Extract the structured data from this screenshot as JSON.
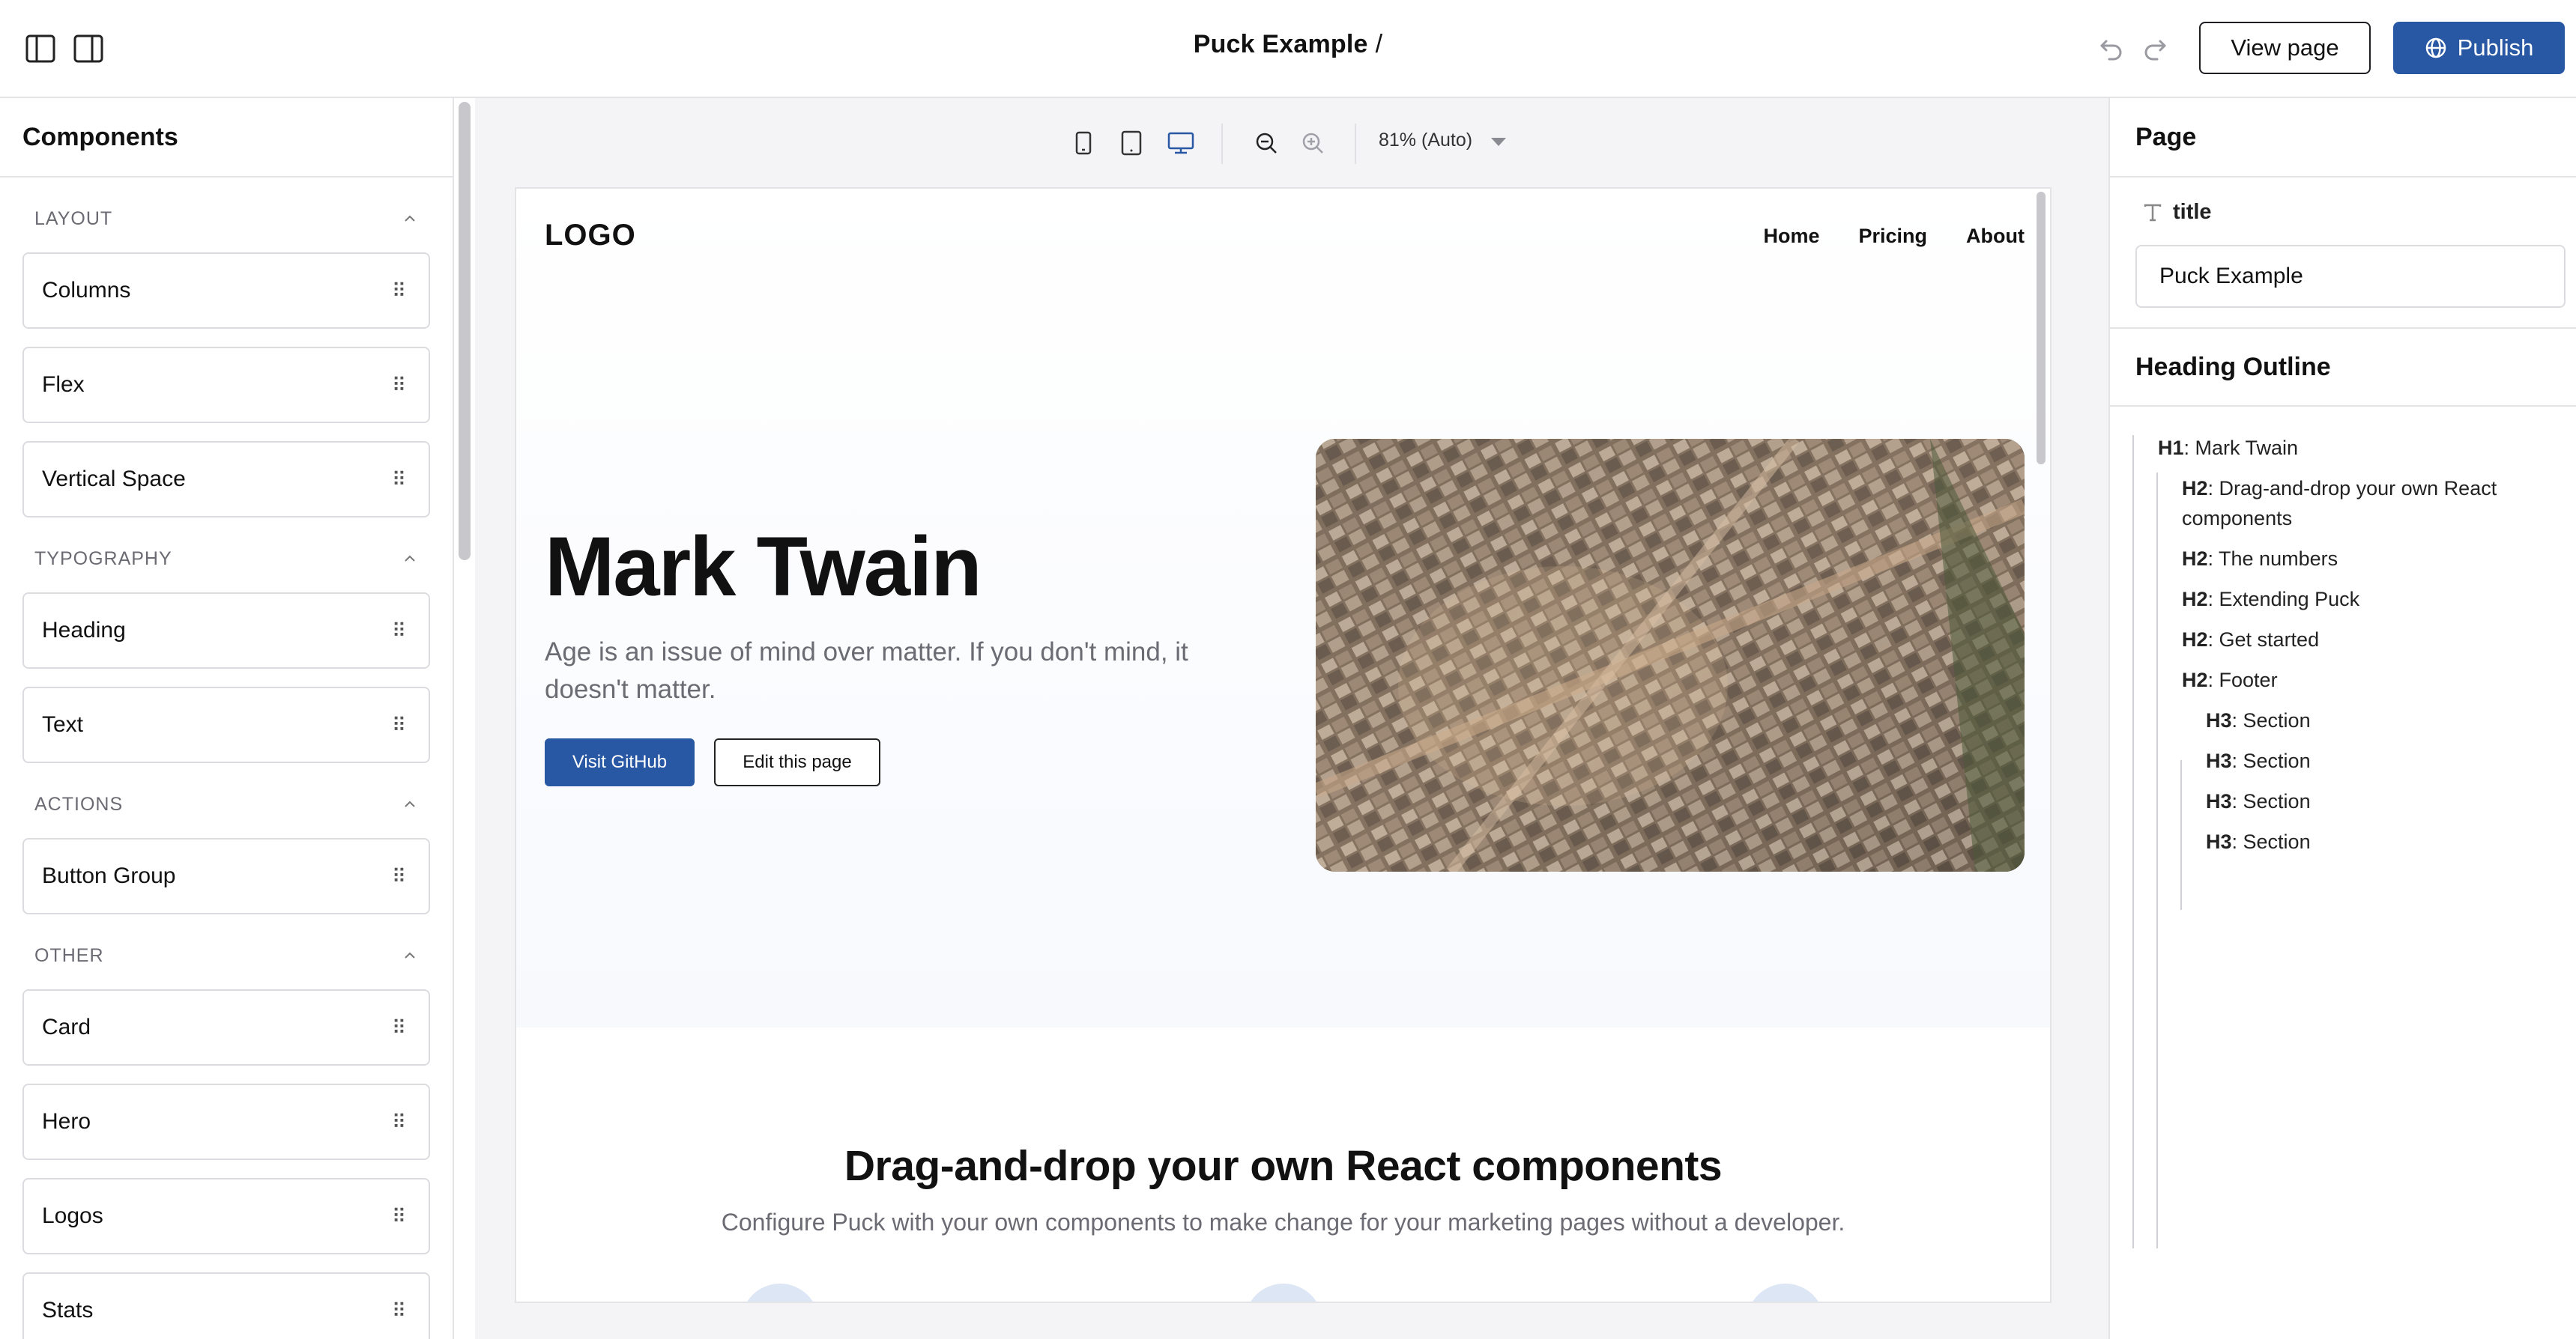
{
  "topbar": {
    "title": "Puck Example",
    "title_suffix": "/",
    "view_page_label": "View page",
    "publish_label": "Publish"
  },
  "components": {
    "title": "Components",
    "categories": [
      {
        "label": "LAYOUT",
        "items": [
          "Columns",
          "Flex",
          "Vertical Space"
        ]
      },
      {
        "label": "TYPOGRAPHY",
        "items": [
          "Heading",
          "Text"
        ]
      },
      {
        "label": "ACTIONS",
        "items": [
          "Button Group"
        ]
      },
      {
        "label": "OTHER",
        "items": [
          "Card",
          "Hero",
          "Logos",
          "Stats"
        ]
      }
    ]
  },
  "canvas": {
    "zoom_label": "81% (Auto)",
    "viewport_icons": [
      "mobile-icon",
      "tablet-icon",
      "desktop-icon"
    ],
    "accent": "#2857a4"
  },
  "preview": {
    "logo": "LOGO",
    "nav": [
      "Home",
      "Pricing",
      "About"
    ],
    "hero_title": "Mark Twain",
    "hero_subtitle": "Age is an issue of mind over matter. If you don't mind, it doesn't matter.",
    "primary_button": "Visit GitHub",
    "secondary_button": "Edit this page",
    "section_title": "Drag-and-drop your own React components",
    "section_subtitle": "Configure Puck with your own components to make change for your marketing pages without a developer."
  },
  "page_panel": {
    "title": "Page",
    "field_label": "title",
    "field_value": "Puck Example",
    "outline_title": "Heading Outline",
    "outline": [
      {
        "level": "H1",
        "text": "Mark Twain"
      },
      {
        "level": "H2",
        "text": "Drag-and-drop your own React components"
      },
      {
        "level": "H2",
        "text": "The numbers"
      },
      {
        "level": "H2",
        "text": "Extending Puck"
      },
      {
        "level": "H2",
        "text": "Get started"
      },
      {
        "level": "H2",
        "text": "Footer"
      },
      {
        "level": "H3",
        "text": "Section"
      },
      {
        "level": "H3",
        "text": "Section"
      },
      {
        "level": "H3",
        "text": "Section"
      },
      {
        "level": "H3",
        "text": "Section"
      }
    ]
  }
}
